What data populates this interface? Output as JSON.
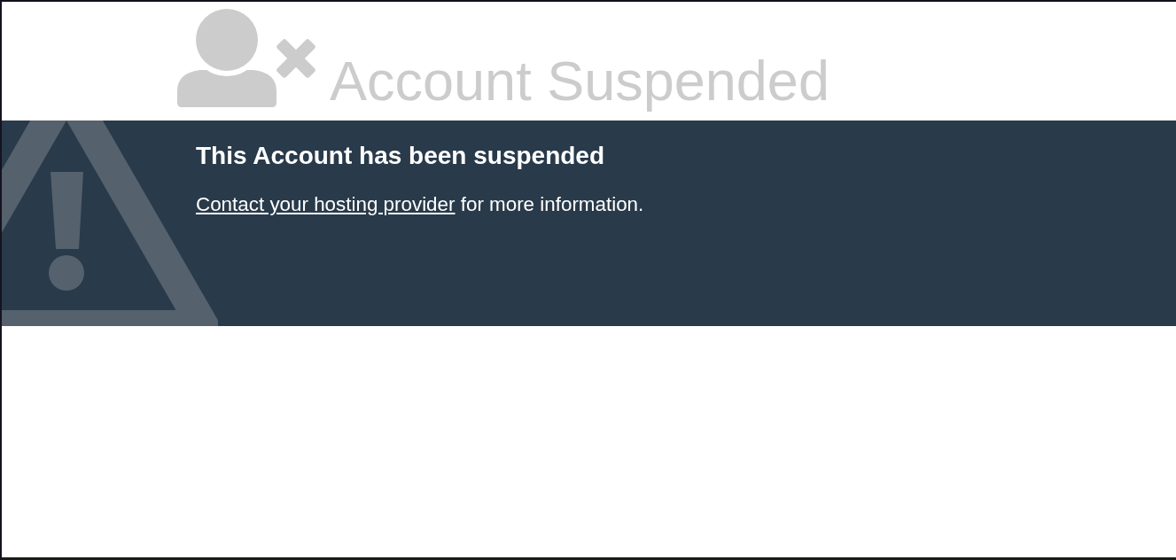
{
  "header": {
    "title": "Account Suspended"
  },
  "notice": {
    "heading": "This Account has been suspended",
    "link": "Contact your hosting provider",
    "text": "for more information."
  }
}
